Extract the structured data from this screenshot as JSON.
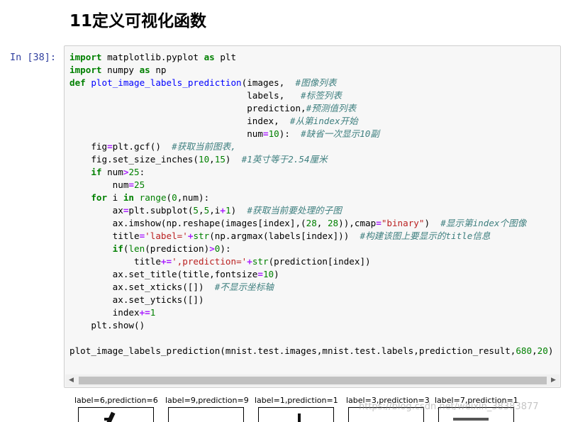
{
  "heading": "11定义可视化函数",
  "cell": {
    "prompt": "In  [38]:",
    "lines": [
      [
        [
          "kw",
          "import"
        ],
        [
          "t",
          " matplotlib.pyplot "
        ],
        [
          "kw",
          "as"
        ],
        [
          "t",
          " plt"
        ]
      ],
      [
        [
          "kw",
          "import"
        ],
        [
          "t",
          " numpy "
        ],
        [
          "kw",
          "as"
        ],
        [
          "t",
          " np"
        ]
      ],
      [
        [
          "kw",
          "def"
        ],
        [
          "t",
          " "
        ],
        [
          "fn",
          "plot_image_labels_prediction"
        ],
        [
          "t",
          "(images,  "
        ],
        [
          "cm",
          "#图像列表"
        ]
      ],
      [
        [
          "t",
          "                                 labels,   "
        ],
        [
          "cm",
          "#标签列表"
        ]
      ],
      [
        [
          "t",
          "                                 prediction,"
        ],
        [
          "cm",
          "#预测值列表"
        ]
      ],
      [
        [
          "t",
          "                                 index,  "
        ],
        [
          "cm",
          "#从第index开始"
        ]
      ],
      [
        [
          "t",
          "                                 num"
        ],
        [
          "op",
          "="
        ],
        [
          "num",
          "10"
        ],
        [
          "t",
          "):  "
        ],
        [
          "cm",
          "#缺省一次显示10副"
        ]
      ],
      [
        [
          "t",
          "    fig"
        ],
        [
          "op",
          "="
        ],
        [
          "t",
          "plt.gcf()  "
        ],
        [
          "cm",
          "#获取当前图表,"
        ]
      ],
      [
        [
          "t",
          "    fig.set_size_inches("
        ],
        [
          "num",
          "10"
        ],
        [
          "t",
          ","
        ],
        [
          "num",
          "15"
        ],
        [
          "t",
          ")  "
        ],
        [
          "cm",
          "#1英寸等于2.54厘米"
        ]
      ],
      [
        [
          "t",
          "    "
        ],
        [
          "kw",
          "if"
        ],
        [
          "t",
          " num"
        ],
        [
          "op",
          ">"
        ],
        [
          "num",
          "25"
        ],
        [
          "t",
          ":"
        ]
      ],
      [
        [
          "t",
          "        num"
        ],
        [
          "op",
          "="
        ],
        [
          "num",
          "25"
        ]
      ],
      [
        [
          "t",
          "    "
        ],
        [
          "kw",
          "for"
        ],
        [
          "t",
          " i "
        ],
        [
          "kw",
          "in"
        ],
        [
          "t",
          " "
        ],
        [
          "bi",
          "range"
        ],
        [
          "t",
          "("
        ],
        [
          "num",
          "0"
        ],
        [
          "t",
          ",num):"
        ]
      ],
      [
        [
          "t",
          "        ax"
        ],
        [
          "op",
          "="
        ],
        [
          "t",
          "plt.subplot("
        ],
        [
          "num",
          "5"
        ],
        [
          "t",
          ","
        ],
        [
          "num",
          "5"
        ],
        [
          "t",
          ",i"
        ],
        [
          "op",
          "+"
        ],
        [
          "num",
          "1"
        ],
        [
          "t",
          ")  "
        ],
        [
          "cm",
          "#获取当前要处理的子图"
        ]
      ],
      [
        [
          "t",
          "        ax.imshow(np.reshape(images[index],("
        ],
        [
          "num",
          "28"
        ],
        [
          "t",
          ", "
        ],
        [
          "num",
          "28"
        ],
        [
          "t",
          ")),cmap"
        ],
        [
          "op",
          "="
        ],
        [
          "str",
          "\"binary\""
        ],
        [
          "t",
          ")  "
        ],
        [
          "cm",
          "#显示第index个图像"
        ]
      ],
      [
        [
          "t",
          "        title"
        ],
        [
          "op",
          "="
        ],
        [
          "str",
          "'label='"
        ],
        [
          "op",
          "+"
        ],
        [
          "bi",
          "str"
        ],
        [
          "t",
          "(np.argmax(labels[index]))  "
        ],
        [
          "cm",
          "#构建该图上要显示的title信息"
        ]
      ],
      [
        [
          "t",
          "        "
        ],
        [
          "kw",
          "if"
        ],
        [
          "t",
          "("
        ],
        [
          "bi",
          "len"
        ],
        [
          "t",
          "(prediction)"
        ],
        [
          "op",
          ">"
        ],
        [
          "num",
          "0"
        ],
        [
          "t",
          "):"
        ]
      ],
      [
        [
          "t",
          "            title"
        ],
        [
          "op",
          "+="
        ],
        [
          "str",
          "',prediction='"
        ],
        [
          "op",
          "+"
        ],
        [
          "bi",
          "str"
        ],
        [
          "t",
          "(prediction[index])"
        ]
      ],
      [
        [
          "t",
          "        ax.set_title(title,fontsize"
        ],
        [
          "op",
          "="
        ],
        [
          "num",
          "10"
        ],
        [
          "t",
          ")"
        ]
      ],
      [
        [
          "t",
          "        ax.set_xticks([])  "
        ],
        [
          "cm",
          "#不显示坐标轴"
        ]
      ],
      [
        [
          "t",
          "        ax.set_yticks([])"
        ]
      ],
      [
        [
          "t",
          "        index"
        ],
        [
          "op",
          "+="
        ],
        [
          "num",
          "1"
        ]
      ],
      [
        [
          "t",
          "    plt.show()"
        ]
      ],
      [
        [
          "t",
          ""
        ]
      ],
      [
        [
          "t",
          "plot_image_labels_prediction(mnist.test.images,mnist.test.labels,prediction_result,"
        ],
        [
          "num",
          "680"
        ],
        [
          "t",
          ","
        ],
        [
          "num",
          "20"
        ],
        [
          "t",
          ")"
        ]
      ]
    ]
  },
  "output": {
    "titles": [
      "label=6,prediction=6",
      "label=9,prediction=9",
      "label=1,prediction=1",
      "label=3,prediction=3",
      "label=7,prediction=1"
    ]
  },
  "watermark": "https://blog.csdn.net/weixin_38383877",
  "colors": {
    "prompt": "#303f9f",
    "keyword": "#008000",
    "function": "#0000ff",
    "string": "#ba2121",
    "operator": "#aa22ff",
    "comment": "#408080",
    "cell_bg": "#f7f7f7",
    "cell_border": "#cfcfcf"
  },
  "icons": {
    "scroll_left": "scroll-left-arrow-icon",
    "scroll_right": "scroll-right-arrow-icon"
  }
}
